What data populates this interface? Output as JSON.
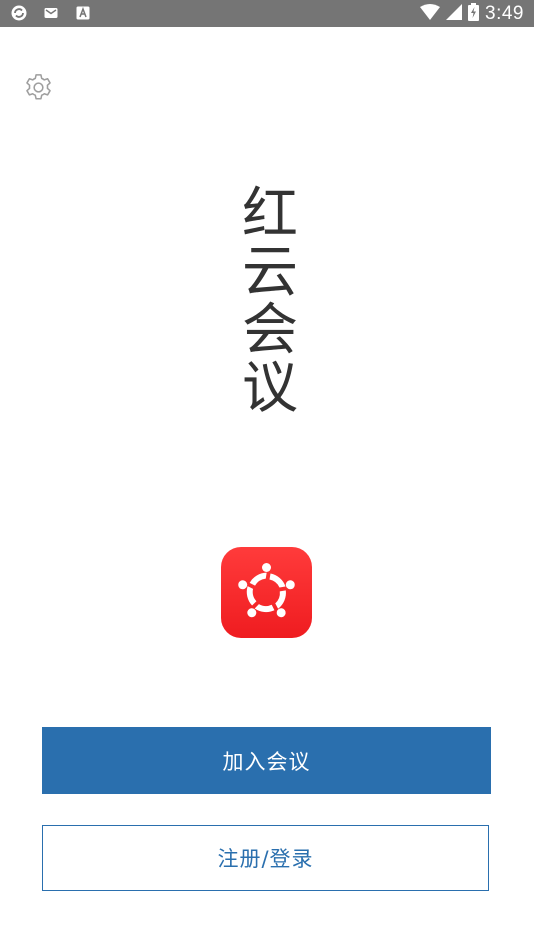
{
  "status_bar": {
    "time": "3:49",
    "icons": [
      "sync-icon",
      "mail-icon",
      "font-a-icon",
      "wifi-icon",
      "signal-icon",
      "battery-charging-icon"
    ]
  },
  "settings": {
    "icon": "gear-icon"
  },
  "app": {
    "title": "红云会议",
    "logo_icon": "people-circle-logo",
    "brand_color": "#ef1c20"
  },
  "actions": {
    "join_label": "加入会议",
    "login_label": "注册/登录",
    "primary_color": "#2a6fae"
  }
}
